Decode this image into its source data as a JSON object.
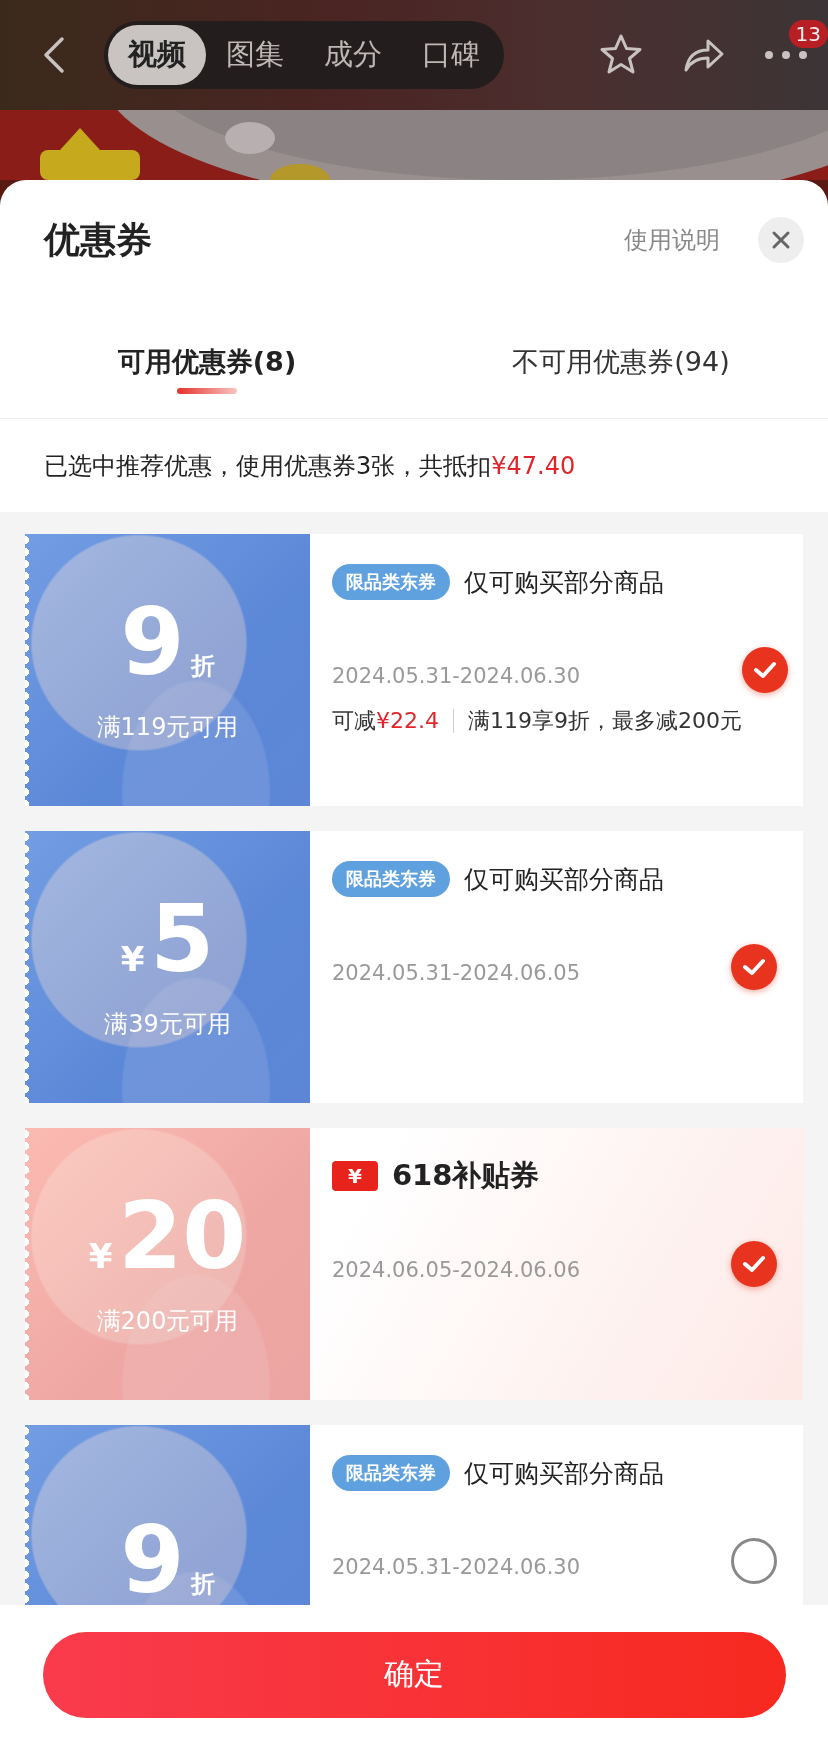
{
  "top_bar": {
    "tabs": [
      {
        "label": "视频",
        "selected": true
      },
      {
        "label": "图集",
        "selected": false
      },
      {
        "label": "成分",
        "selected": false
      },
      {
        "label": "口碑",
        "selected": false
      }
    ],
    "badge": "13"
  },
  "sheet": {
    "title": "优惠券",
    "help_link": "使用说明"
  },
  "tabs": [
    {
      "label": "可用优惠券(8)",
      "selected": true
    },
    {
      "label": "不可用优惠券(94)",
      "selected": false
    }
  ],
  "summary": {
    "text": "已选中推荐优惠，使用优惠券3张，共抵扣",
    "amount": "¥47.40"
  },
  "coupons": [
    {
      "kind": "discount",
      "color": "#5f90e0",
      "value": "9",
      "unit": "折",
      "condition": "满119元可用",
      "tag": {
        "kind": "pill",
        "text": "限品类东券"
      },
      "title": "仅可购买部分商品",
      "dates": "2024.05.31-2024.06.30",
      "saving_label": "可减",
      "saving": "¥22.4",
      "rule": "满119享9折，最多减200元",
      "selected": true
    },
    {
      "kind": "cash",
      "color": "#5f90e0",
      "currency": "¥",
      "value": "5",
      "condition": "满39元可用",
      "tag": {
        "kind": "pill",
        "text": "限品类东券"
      },
      "title": "仅可购买部分商品",
      "dates": "2024.05.31-2024.06.05",
      "selected": true
    },
    {
      "kind": "cash",
      "color": "#fbb1a8",
      "currency": "¥",
      "value": "20",
      "condition": "满200元可用",
      "tag": {
        "kind": "ticket",
        "text": "¥"
      },
      "title": "618补贴券",
      "dates": "2024.06.05-2024.06.06",
      "selected": true
    },
    {
      "kind": "discount",
      "color": "#5f90e0",
      "value": "9",
      "unit": "折",
      "tag": {
        "kind": "pill",
        "text": "限品类东券"
      },
      "title": "仅可购买部分商品",
      "dates": "2024.05.31-2024.06.30",
      "selected": false
    }
  ],
  "confirm_button": "确定"
}
